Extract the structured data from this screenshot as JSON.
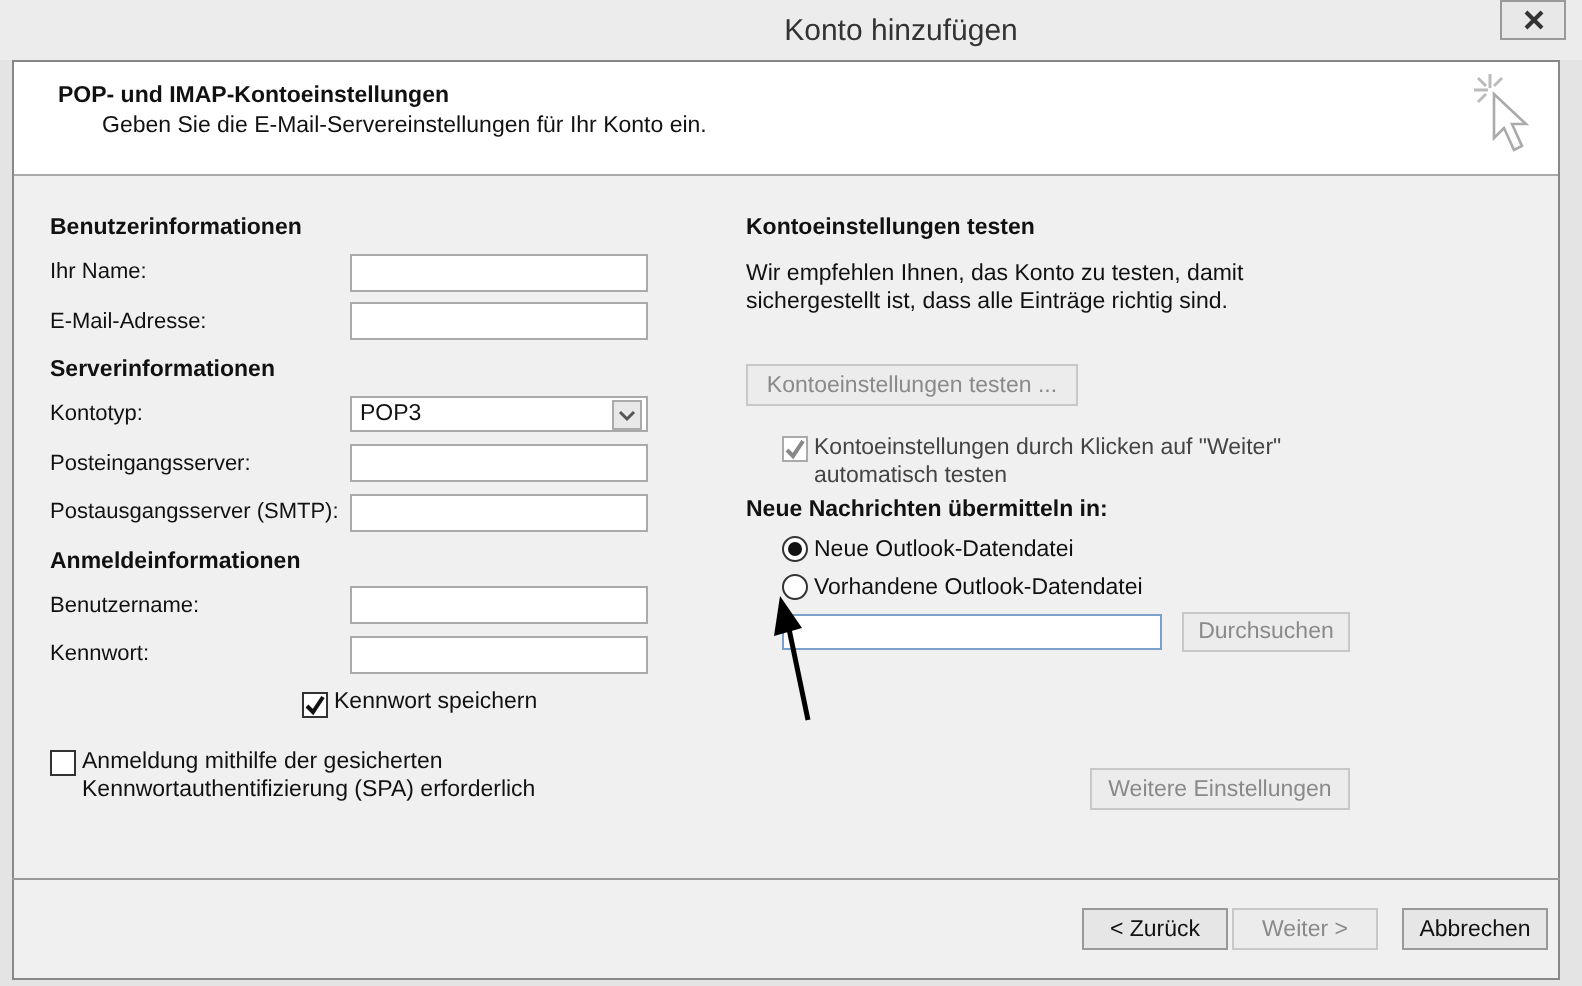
{
  "window": {
    "title": "Konto hinzufügen"
  },
  "header": {
    "title": "POP- und IMAP-Kontoeinstellungen",
    "subtitle": "Geben Sie die E-Mail-Servereinstellungen für Ihr Konto ein."
  },
  "left": {
    "sections": [
      {
        "heading": "Benutzerinformationen",
        "fields": [
          {
            "label": "Ihr Name:",
            "kind": "text"
          },
          {
            "label": "E-Mail-Adresse:",
            "kind": "text"
          }
        ]
      },
      {
        "heading": "Serverinformationen",
        "fields": [
          {
            "label": "Kontotyp:",
            "kind": "select",
            "value": "POP3"
          },
          {
            "label": "Posteingangsserver:",
            "kind": "text"
          },
          {
            "label": "Postausgangsserver (SMTP):",
            "kind": "text"
          }
        ]
      },
      {
        "heading": "Anmeldeinformationen",
        "fields": [
          {
            "label": "Benutzername:",
            "kind": "text"
          },
          {
            "label": "Kennwort:",
            "kind": "text"
          }
        ]
      }
    ],
    "save_password": {
      "label": "Kennwort speichern",
      "checked": true
    },
    "spa": {
      "label": "Anmeldung mithilfe der gesicherten\nKennwortauthentifizierung (SPA) erforderlich",
      "checked": false
    }
  },
  "right": {
    "test_heading": "Kontoeinstellungen testen",
    "test_text": "Wir empfehlen Ihnen, das Konto zu testen, damit\nsichergestellt ist, dass alle Einträge richtig sind.",
    "test_button": {
      "label": "Kontoeinstellungen testen ...",
      "disabled": true
    },
    "auto_test": {
      "label": "Kontoeinstellungen durch Klicken auf \"Weiter\"\nautomatisch testen",
      "checked": true,
      "disabled": true
    },
    "deliver_heading": "Neue Nachrichten übermitteln in:",
    "options": [
      {
        "label": "Neue Outlook-Datendatei",
        "selected": true
      },
      {
        "label": "Vorhandene Outlook-Datendatei",
        "selected": false
      }
    ],
    "browse_button": {
      "label": "Durchsuchen",
      "disabled": true
    },
    "more_button": {
      "label": "Weitere Einstellungen",
      "disabled": true
    }
  },
  "footer": {
    "buttons": [
      {
        "label": "< Zurück",
        "disabled": false
      },
      {
        "label": "Weiter >",
        "disabled": true
      },
      {
        "label": "Abbrechen",
        "disabled": false
      }
    ]
  }
}
